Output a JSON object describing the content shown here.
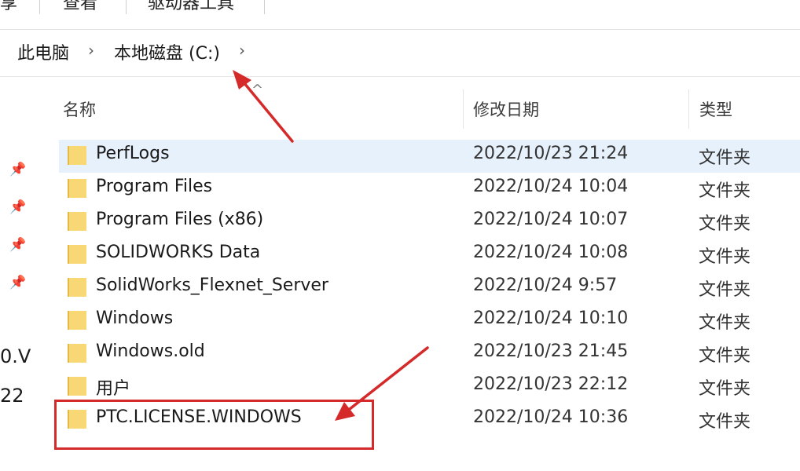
{
  "menu": {
    "items": [
      "享",
      "查看",
      "驱动器工具"
    ]
  },
  "breadcrumb": {
    "items": [
      "此电脑",
      "本地磁盘 (C:)"
    ]
  },
  "nav_pane": {
    "partial_texts": [
      "0.V",
      "22"
    ]
  },
  "columns": {
    "name": "名称",
    "date": "修改日期",
    "type": "类型"
  },
  "files": [
    {
      "name": "PerfLogs",
      "date": "2022/10/23 21:24",
      "type": "文件夹"
    },
    {
      "name": "Program Files",
      "date": "2022/10/24 10:04",
      "type": "文件夹"
    },
    {
      "name": "Program Files (x86)",
      "date": "2022/10/24 10:07",
      "type": "文件夹"
    },
    {
      "name": "SOLIDWORKS Data",
      "date": "2022/10/24 10:08",
      "type": "文件夹"
    },
    {
      "name": "SolidWorks_Flexnet_Server",
      "date": "2022/10/24 9:57",
      "type": "文件夹"
    },
    {
      "name": "Windows",
      "date": "2022/10/24 10:10",
      "type": "文件夹"
    },
    {
      "name": "Windows.old",
      "date": "2022/10/23 21:45",
      "type": "文件夹"
    },
    {
      "name": "用户",
      "date": "2022/10/23 22:12",
      "type": "文件夹"
    },
    {
      "name": "PTC.LICENSE.WINDOWS",
      "date": "2022/10/24 10:36",
      "type": "文件夹"
    }
  ],
  "colors": {
    "selection": "#e7f1fc",
    "annotation_red": "#d42a2a",
    "folder_yellow": "#f8d775"
  },
  "icons": [
    "pin-icon",
    "folder-icon",
    "chevron-right-icon",
    "sort-caret-icon"
  ]
}
